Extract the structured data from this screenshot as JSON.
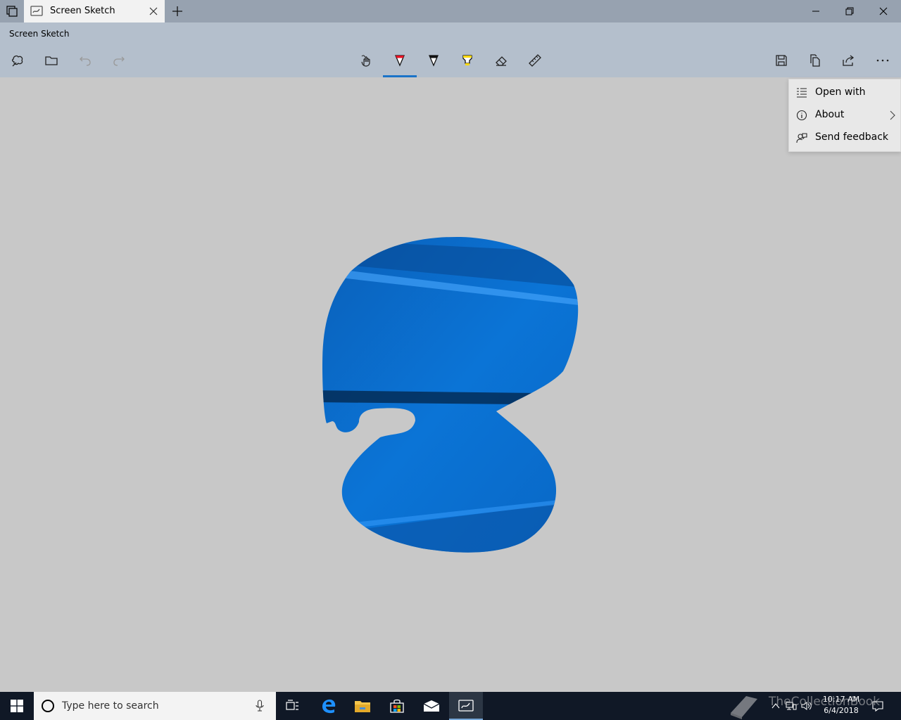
{
  "window": {
    "tab_title": "Screen Sketch",
    "app_title": "Screen Sketch"
  },
  "toolbar": {
    "left": [
      "new-snip-icon",
      "open-folder-icon",
      "undo-icon",
      "redo-icon"
    ],
    "center": [
      "touch-writing-icon",
      "ballpoint-pen-icon",
      "pencil-icon",
      "highlighter-icon",
      "eraser-icon",
      "ruler-icon"
    ],
    "right": [
      "save-icon",
      "copy-icon",
      "share-icon",
      "more-icon"
    ],
    "selected_tool": "ballpoint-pen-icon",
    "accent_color": "#1a73c8"
  },
  "menu": {
    "items": [
      {
        "label": "Open with",
        "icon": "open-with-icon"
      },
      {
        "label": "About",
        "icon": "info-icon",
        "has_submenu": true
      },
      {
        "label": "Send feedback",
        "icon": "feedback-icon"
      }
    ]
  },
  "canvas": {
    "background": "#c8c8c8",
    "snip_color": "#0a6fd1"
  },
  "taskbar": {
    "search_placeholder": "Type here to search",
    "apps": [
      "task-view-icon",
      "edge-icon",
      "file-explorer-icon",
      "store-icon",
      "mail-icon",
      "screen-sketch-icon"
    ],
    "active_app": "screen-sketch-icon",
    "clock_time": "10:17 AM",
    "clock_date": "6/4/2018",
    "watermark": "TheCollectionBook"
  }
}
